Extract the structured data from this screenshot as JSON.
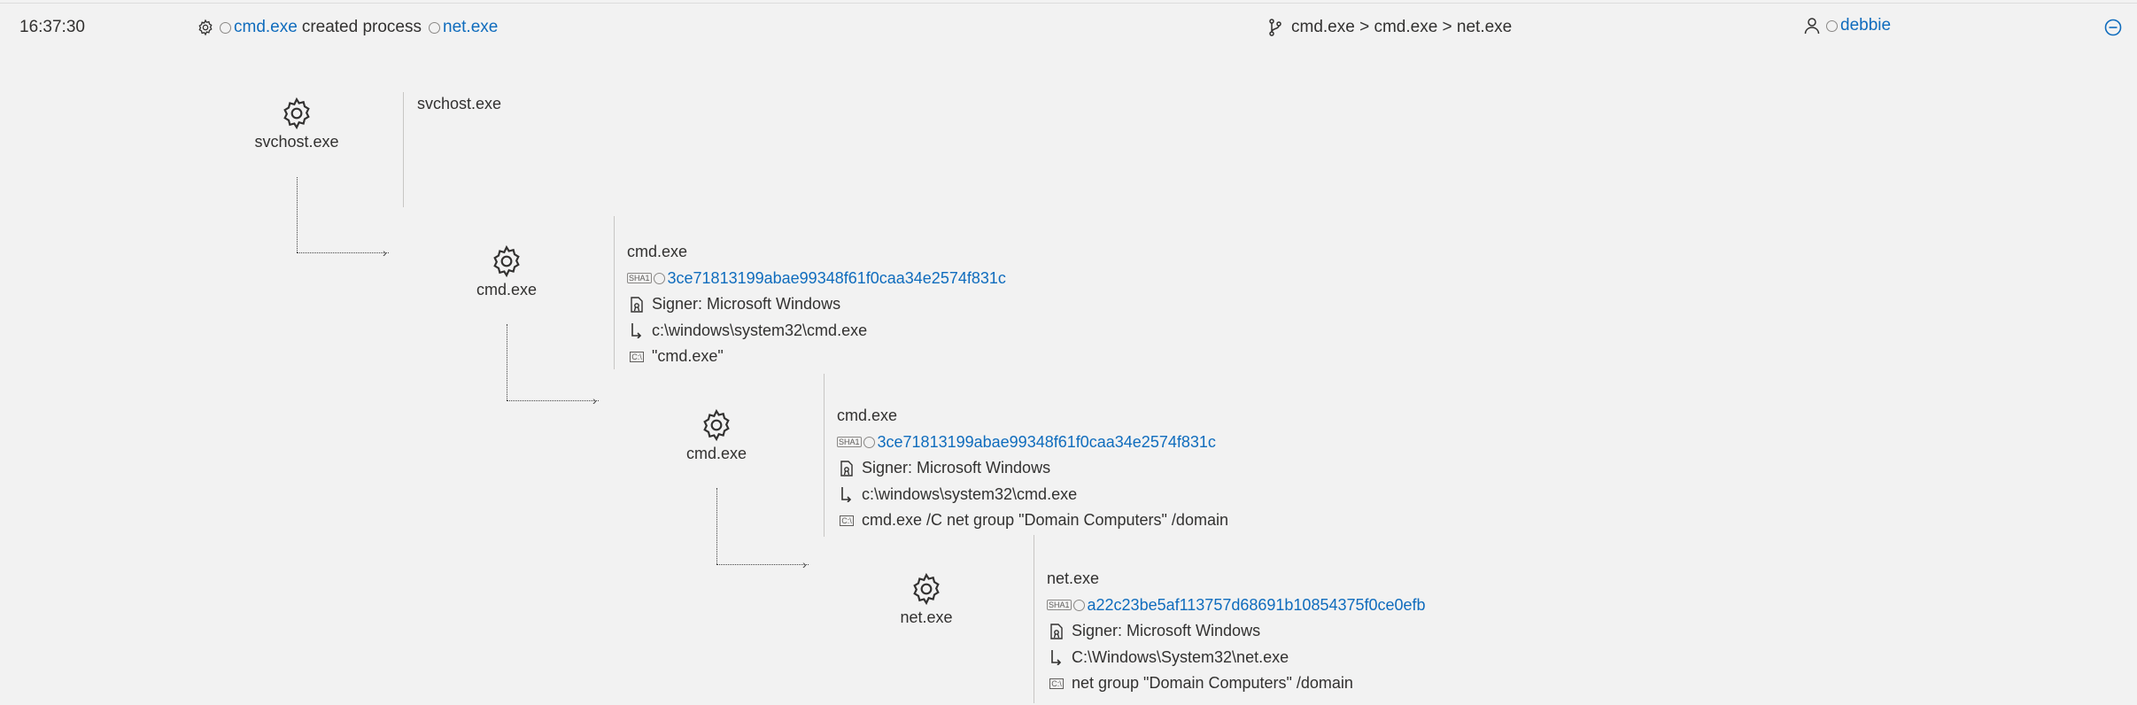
{
  "header": {
    "time": "16:37:30",
    "event": {
      "icon": "gear-icon",
      "actor": "cmd.exe",
      "action": "created process",
      "target": "net.exe"
    },
    "path": {
      "icon": "branch-icon",
      "text": "cmd.exe > cmd.exe > net.exe"
    },
    "user": {
      "icon": "user-icon",
      "name": "debbie"
    },
    "collapse_icon": "minus-circle-icon"
  },
  "tree": [
    {
      "label": "svchost.exe",
      "title": "svchost.exe"
    },
    {
      "label": "cmd.exe",
      "title": "cmd.exe",
      "sha1_tag": "SHA1",
      "sha1": "3ce71813199abae99348f61f0caa34e2574f831c",
      "signer": "Signer: Microsoft Windows",
      "path": "c:\\windows\\system32\\cmd.exe",
      "cmd_tag": "C:\\",
      "cmdline": "\"cmd.exe\""
    },
    {
      "label": "cmd.exe",
      "title": "cmd.exe",
      "sha1_tag": "SHA1",
      "sha1": "3ce71813199abae99348f61f0caa34e2574f831c",
      "signer": "Signer: Microsoft Windows",
      "path": "c:\\windows\\system32\\cmd.exe",
      "cmd_tag": "C:\\",
      "cmdline": "cmd.exe /C net group \"Domain Computers\" /domain"
    },
    {
      "label": "net.exe",
      "title": "net.exe",
      "sha1_tag": "SHA1",
      "sha1": "a22c23be5af113757d68691b10854375f0ce0efb",
      "signer": "Signer: Microsoft Windows",
      "path": "C:\\Windows\\System32\\net.exe",
      "cmd_tag": "C:\\",
      "cmdline": "net group \"Domain Computers\" /domain"
    }
  ]
}
